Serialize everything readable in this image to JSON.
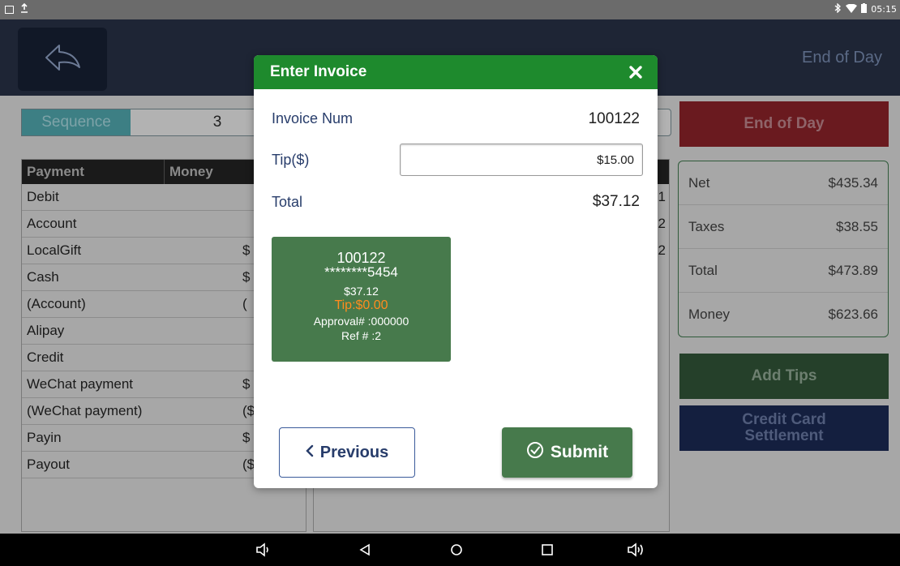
{
  "status_bar": {
    "time": "05:15",
    "icons": [
      "image-icon",
      "upload-icon",
      "bluetooth-icon",
      "wifi-icon",
      "battery-icon"
    ]
  },
  "header": {
    "title": "End of Day",
    "back_icon": "back-arrow-icon"
  },
  "sequence": {
    "label": "Sequence",
    "value": "3"
  },
  "payment_table": {
    "columns": [
      "Payment",
      "Money"
    ],
    "rows": [
      {
        "payment": "Debit",
        "money": ""
      },
      {
        "payment": "Account",
        "money": ""
      },
      {
        "payment": "LocalGift",
        "money": "$"
      },
      {
        "payment": "Cash",
        "money": "$"
      },
      {
        "payment": "(Account)",
        "money": "("
      },
      {
        "payment": "Alipay",
        "money": ""
      },
      {
        "payment": "Credit",
        "money": ""
      },
      {
        "payment": "WeChat payment",
        "money": "$"
      },
      {
        "payment": "(WeChat payment)",
        "money": "($"
      },
      {
        "payment": "Payin",
        "money": "$"
      },
      {
        "payment": "Payout",
        "money": "($"
      }
    ]
  },
  "middle_table": {
    "row_values": [
      "1",
      "2",
      "2"
    ]
  },
  "right_panel": {
    "end_of_day_label": "End of Day",
    "summary": [
      {
        "label": "Net",
        "value": "$435.34"
      },
      {
        "label": "Taxes",
        "value": "$38.55"
      },
      {
        "label": "Total",
        "value": "$473.89"
      },
      {
        "label": "Money",
        "value": "$623.66"
      }
    ],
    "add_tips_label": "Add Tips",
    "credit_card_settlement_line1": "Credit Card",
    "credit_card_settlement_line2": "Settlement"
  },
  "modal": {
    "title": "Enter Invoice",
    "invoice_label": "Invoice Num",
    "invoice_value": "100122",
    "tip_label": "Tip($)",
    "tip_value": "$15.00",
    "total_label": "Total",
    "total_value": "$37.12",
    "card": {
      "invoice": "100122",
      "card_number": "********5454",
      "amount": "$37.12",
      "tip": "Tip:$0.00",
      "approval": "Approval# :000000",
      "ref": "Ref # :2"
    },
    "previous_label": "Previous",
    "submit_label": "Submit"
  },
  "colors": {
    "modal_header": "#1e8a2d",
    "card_bg": "#477a4c",
    "tip_orange": "#ff8c1e",
    "label_blue": "#283d6b"
  }
}
